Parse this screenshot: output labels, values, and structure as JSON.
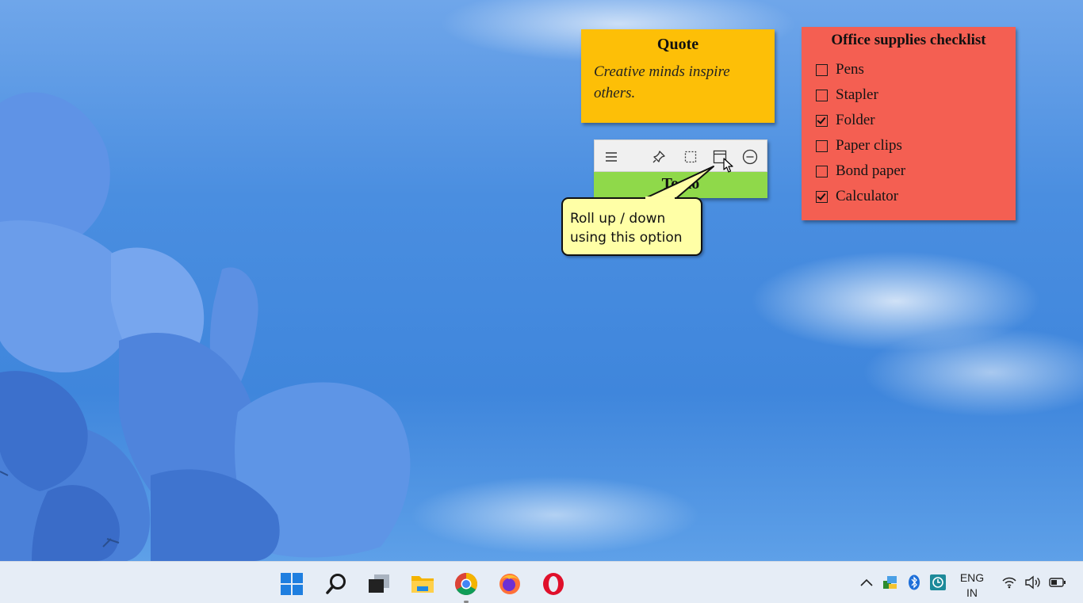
{
  "desktop": {
    "wallpaper": "blue-flowers-sky"
  },
  "notes": {
    "quote": {
      "title": "Quote",
      "body": "Creative minds inspire others.",
      "color": "#fdbf07"
    },
    "checklist": {
      "title": "Office supplies checklist",
      "color": "#f45f52",
      "items": [
        {
          "label": "Pens",
          "checked": false
        },
        {
          "label": "Stapler",
          "checked": false
        },
        {
          "label": "Folder",
          "checked": true
        },
        {
          "label": "Paper clips",
          "checked": false
        },
        {
          "label": "Bond paper",
          "checked": false
        },
        {
          "label": "Calculator",
          "checked": true
        }
      ]
    },
    "todo": {
      "title": "To do",
      "color": "#8fd94a",
      "toolbar_icons": [
        "menu-icon",
        "pin-icon",
        "select-icon",
        "roll-up-icon",
        "minimize-icon"
      ]
    }
  },
  "callout": {
    "text": "Roll up / down\nusing this option"
  },
  "taskbar": {
    "apps": [
      "windows-start-icon",
      "search-icon",
      "task-view-icon",
      "file-explorer-icon",
      "chrome-icon",
      "firefox-icon",
      "opera-icon"
    ],
    "tray_icons": [
      "chevron-up-icon",
      "network-app-icon",
      "bluetooth-icon",
      "backup-icon",
      "wifi-icon",
      "volume-icon",
      "battery-icon"
    ],
    "language": {
      "line1": "ENG",
      "line2": "IN"
    }
  }
}
